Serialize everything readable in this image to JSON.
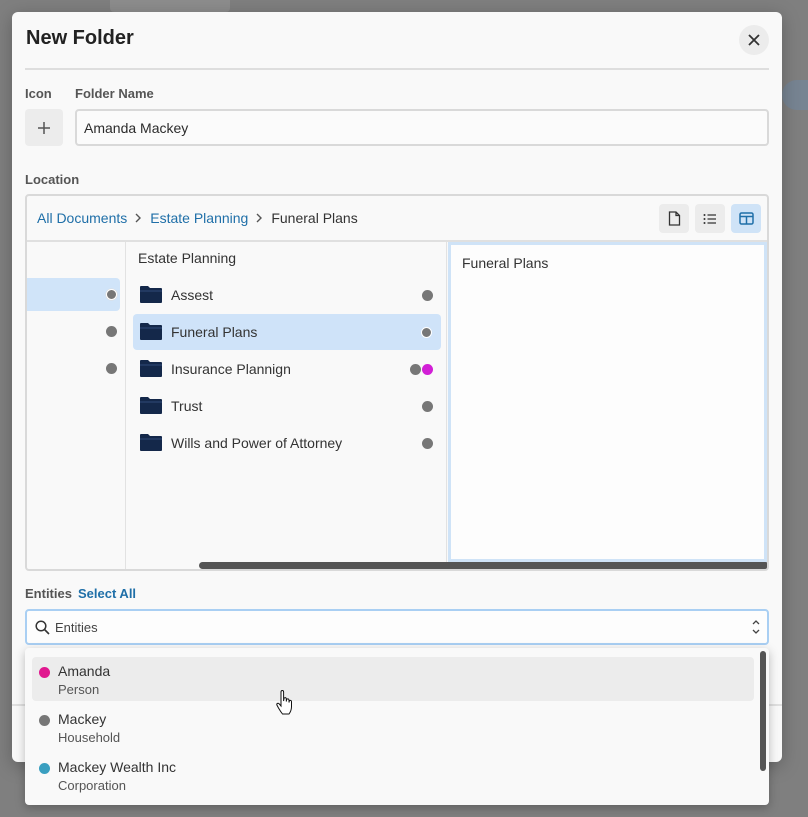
{
  "modal": {
    "title": "New Folder",
    "close_icon": "close-icon"
  },
  "fields": {
    "icon_label": "Icon",
    "icon_button_icon": "plus-icon",
    "folder_name_label": "Folder Name",
    "folder_name_value": "Amanda Mackey",
    "location_label": "Location"
  },
  "location": {
    "breadcrumb": [
      {
        "label": "All Documents",
        "link": true
      },
      {
        "label": "Estate Planning",
        "link": true
      },
      {
        "label": "Funeral Plans",
        "link": false
      }
    ],
    "view_buttons": [
      {
        "icon": "document-icon",
        "active": false
      },
      {
        "icon": "list-icon",
        "active": false
      },
      {
        "icon": "columns-icon",
        "active": true
      }
    ],
    "column2_header": "Estate Planning",
    "folders": [
      {
        "label": "Assest",
        "selected": false,
        "dots": [
          "#777777"
        ]
      },
      {
        "label": "Funeral Plans",
        "selected": true,
        "dots": [
          "#777777"
        ]
      },
      {
        "label": "Insurance Plannign",
        "selected": false,
        "dots": [
          "#777777",
          "#d21fd6"
        ]
      },
      {
        "label": "Trust",
        "selected": false,
        "dots": [
          "#777777"
        ]
      },
      {
        "label": "Wills and Power of Attorney",
        "selected": false,
        "dots": [
          "#777777"
        ]
      }
    ],
    "column3_header": "Funeral Plans"
  },
  "entities": {
    "label": "Entities",
    "select_all": "Select All",
    "input_text": "Entities",
    "options": [
      {
        "name": "Amanda",
        "type": "Person",
        "color": "#e0188f",
        "hover": true
      },
      {
        "name": "Mackey",
        "type": "Household",
        "color": "#777777",
        "hover": false
      },
      {
        "name": "Mackey Wealth Inc",
        "type": "Corporation",
        "color": "#3a9fc0",
        "hover": false
      }
    ]
  },
  "colors": {
    "accent": "#1f6fa8",
    "selection": "#cfe3f9",
    "folder": "#14284a"
  }
}
